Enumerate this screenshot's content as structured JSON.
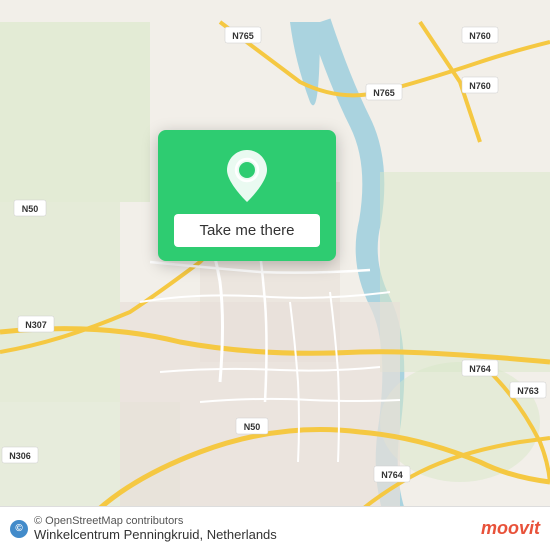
{
  "map": {
    "center_lat": 52.46,
    "center_lng": 5.87,
    "zoom": 12,
    "bg_color": "#f2efe9"
  },
  "overlay": {
    "button_label": "Take me there",
    "bg_color": "#2ecc71"
  },
  "bottom_bar": {
    "attribution": "© OpenStreetMap contributors",
    "location_name": "Winkelcentrum Penningkruid, Netherlands",
    "moovit_label": "moovit"
  },
  "road_labels": [
    "N765",
    "N760",
    "N50",
    "N307",
    "N764",
    "N763",
    "N306"
  ]
}
